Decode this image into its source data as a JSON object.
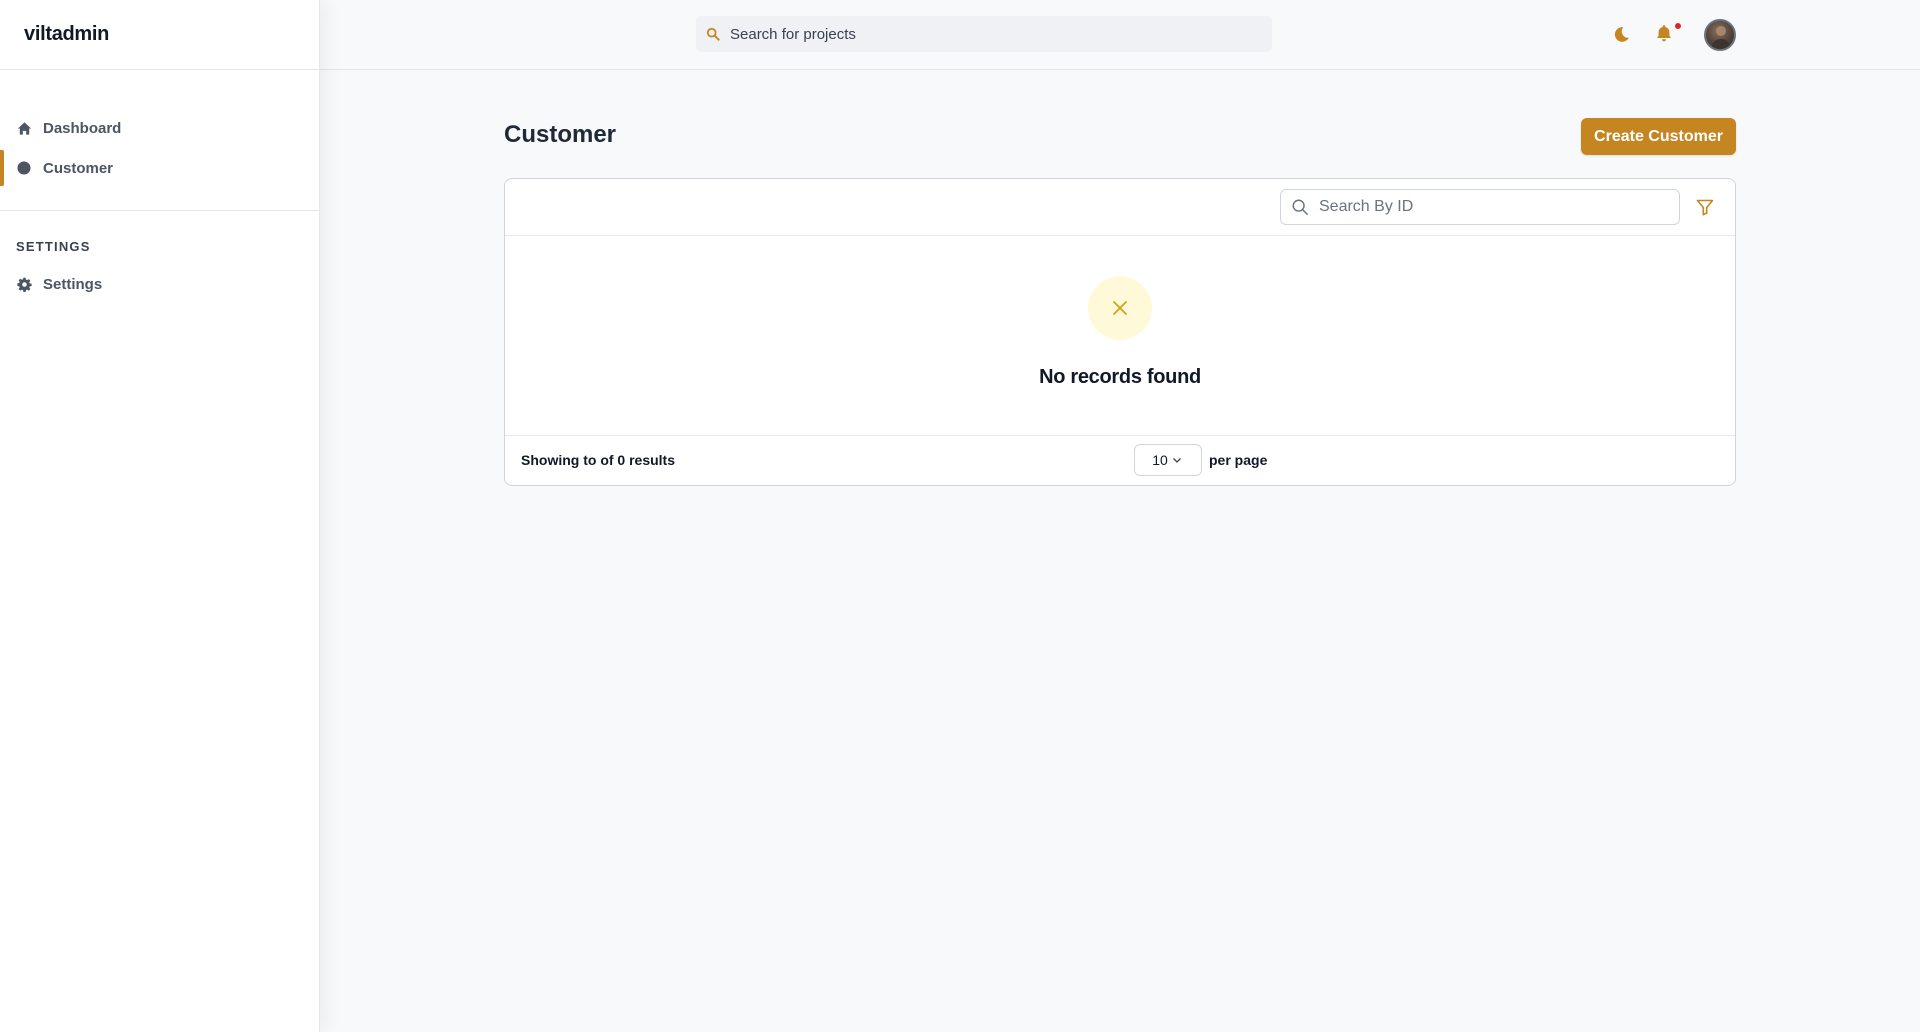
{
  "app": {
    "brand": "viltadmin"
  },
  "sidebar": {
    "items": [
      {
        "label": "Dashboard",
        "icon": "home-icon",
        "active": false
      },
      {
        "label": "Customer",
        "icon": "circle-icon",
        "active": true
      }
    ],
    "settings_section": {
      "title": "SETTINGS",
      "items": [
        {
          "label": "Settings",
          "icon": "gear-icon"
        }
      ]
    }
  },
  "topbar": {
    "search_placeholder": "Search for projects",
    "icons": [
      "moon-icon",
      "bell-icon",
      "avatar"
    ],
    "notification_dot": true
  },
  "main": {
    "title": "Customer",
    "create_button": "Create Customer",
    "table": {
      "search_placeholder": "Search By ID",
      "empty_message": "No records found",
      "footer": {
        "showing_text": "Showing to of 0 results",
        "per_page_value": "10",
        "per_page_label": "per page"
      }
    }
  },
  "colors": {
    "accent": "#c58521",
    "empty_icon_bg": "#fef9d9",
    "notification_dot": "#dc2626"
  }
}
